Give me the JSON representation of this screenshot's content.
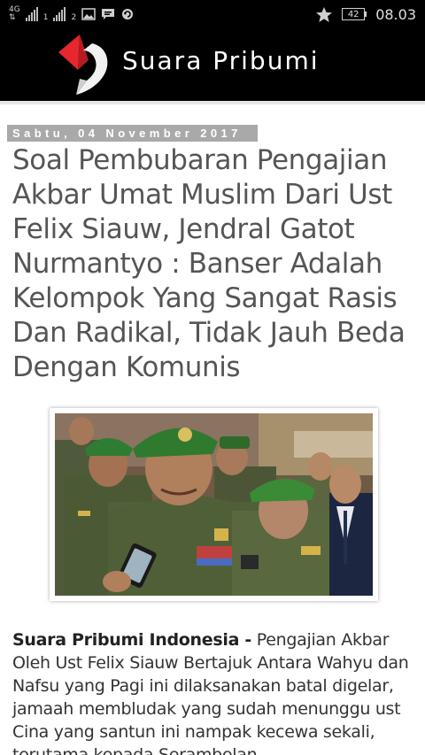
{
  "status_bar": {
    "network_label": "4G",
    "sim1": "1",
    "sim2": "2",
    "icons": [
      "signal-icon",
      "signal-icon",
      "image-icon",
      "message-icon",
      "sync-icon",
      "star-icon",
      "battery-icon"
    ],
    "battery": "42",
    "time": "08.03"
  },
  "header": {
    "site_name": "Suara Pribumi",
    "brand_red": "#e8262d",
    "background": "#000000"
  },
  "article": {
    "date": "Sabtu, 04 November 2017",
    "title": "Soal Pembubaran Pengajian Akbar Umat Muslim Dari Ust Felix Siauw, Jendral Gatot Nurmantyo : Banser Adalah Kelompok Yang Sangat Rasis Dan Radikal, Tidak Jauh Beda Dengan Komunis",
    "lead_source": "Suara Pribumi Indonesia -",
    "lead_text": " Pengajian Akbar Oleh Ust Felix Siauw Bertajuk Antara Wahyu dan Nafsu yang Pagi ini dilaksanakan batal digelar,  jamaah membludak yang sudah menunggu ust Cina yang santun ini nampak kecewa sekali, terutama kepada Serambelan"
  }
}
